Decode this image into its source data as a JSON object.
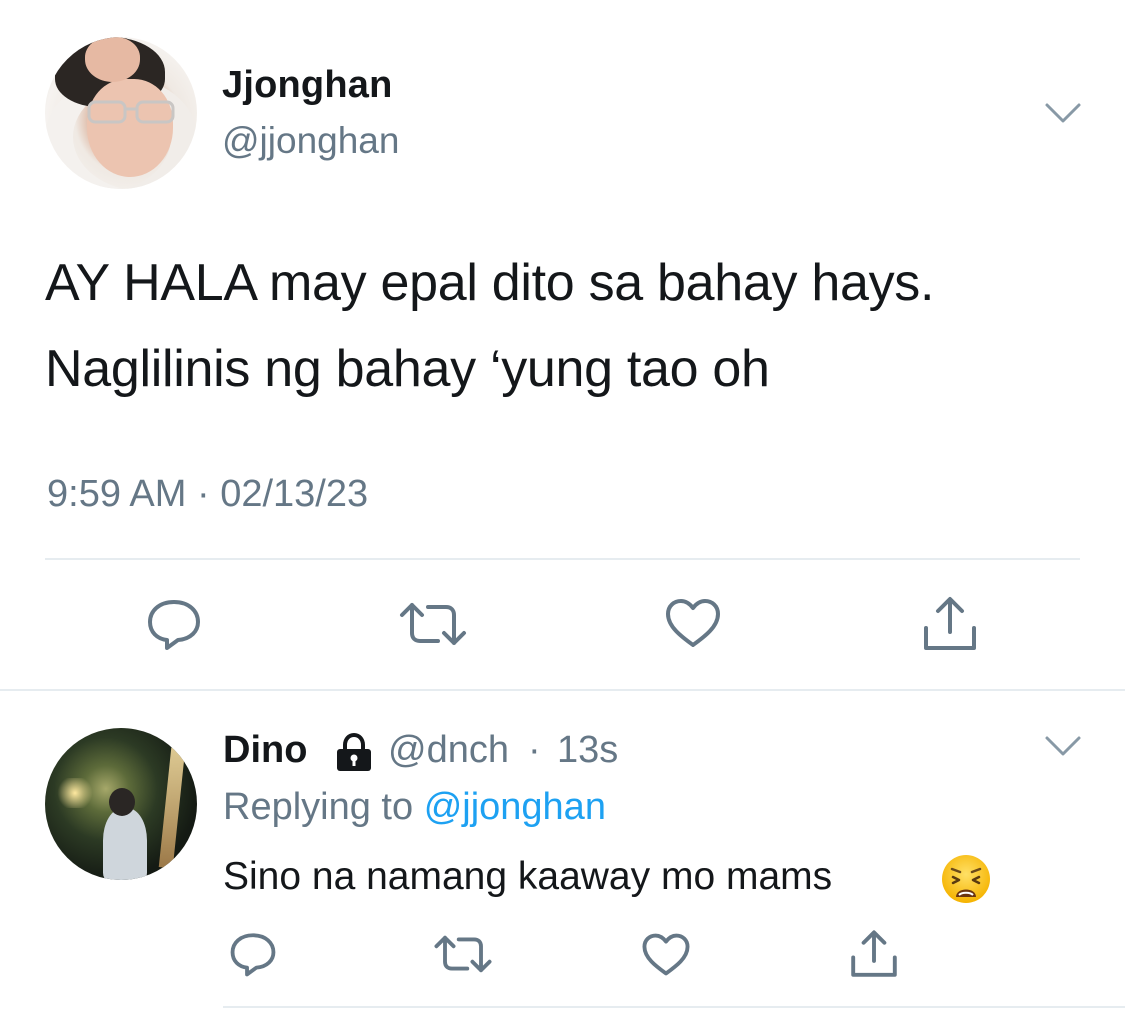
{
  "main_tweet": {
    "display_name": "Jjonghan",
    "handle": "@jjonghan",
    "text_line_1": "AY HALA may epal dito sa bahay hays.",
    "text_line_2": "Naglilinis ng bahay ‘yung tao oh",
    "timestamp": "9:59 AM · 02/13/23",
    "actions": [
      "reply-icon",
      "retweet-icon",
      "like-icon",
      "share-icon"
    ],
    "menu_icon": "chevron-down-icon"
  },
  "reply_tweet": {
    "display_name": "Dino",
    "protected_icon": "lock-icon",
    "handle": "@dnch",
    "separator": "·",
    "time": "13s",
    "replying_to_label": "Replying to",
    "replying_to_handle": "@jjonghan",
    "text": "Sino na namang kaaway mo mams",
    "emoji": "weary-face-emoji",
    "actions": [
      "reply-icon",
      "retweet-icon",
      "like-icon",
      "share-icon"
    ],
    "menu_icon": "chevron-down-icon"
  },
  "colors": {
    "primary_text": "#14171a",
    "secondary_text": "#657786",
    "link": "#1da1f2",
    "divider": "#e6ecf0",
    "icon_stroke": "#657786"
  }
}
